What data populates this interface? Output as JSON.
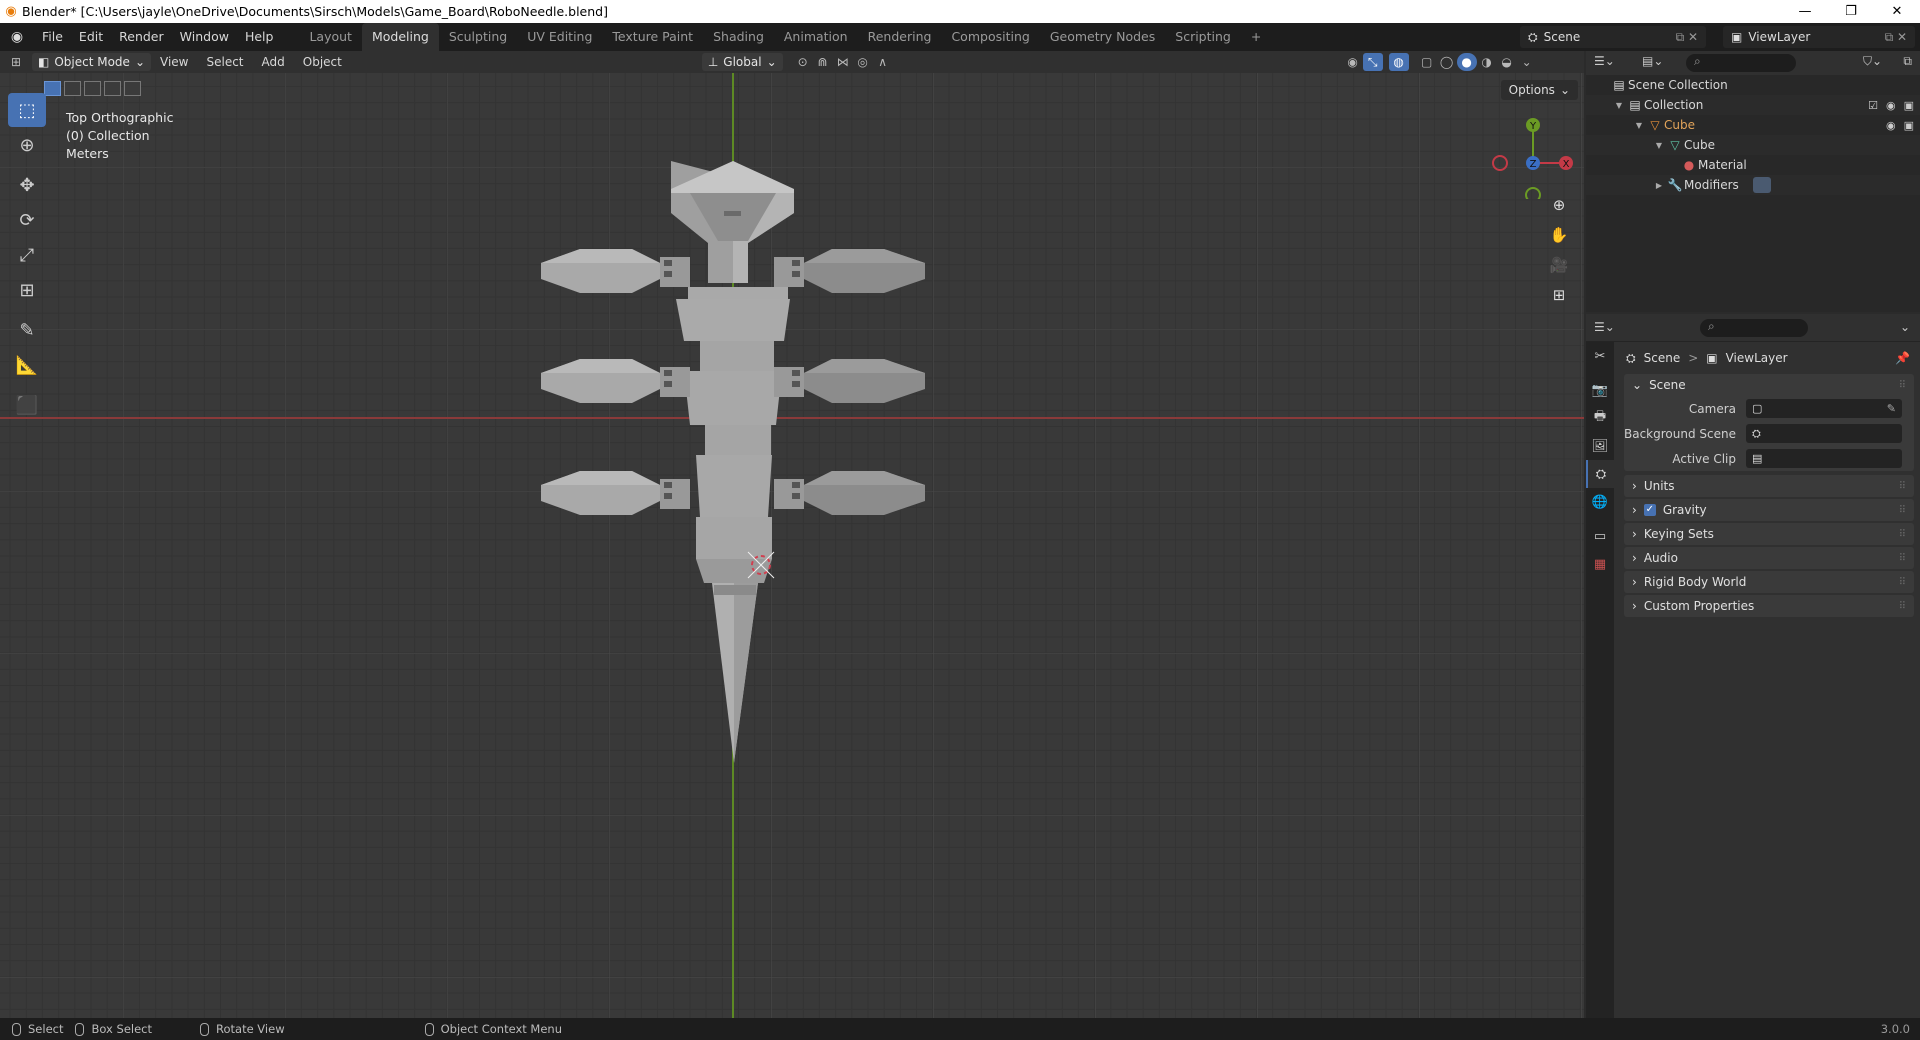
{
  "titlebar": {
    "title": "Blender* [C:\\Users\\jayle\\OneDrive\\Documents\\Sirsch\\Models\\Game_Board\\RoboNeedle.blend]",
    "minimize": "—",
    "maximize": "❐",
    "close": "✕"
  },
  "menu": {
    "items": [
      "File",
      "Edit",
      "Render",
      "Window",
      "Help"
    ],
    "workspaces": [
      "Layout",
      "Modeling",
      "Sculpting",
      "UV Editing",
      "Texture Paint",
      "Shading",
      "Animation",
      "Rendering",
      "Compositing",
      "Geometry Nodes",
      "Scripting"
    ],
    "add_workspace": "+",
    "active_workspace": "Modeling",
    "scene": "Scene",
    "view_layer": "ViewLayer"
  },
  "viewport_header": {
    "mode": "Object Mode",
    "menus": [
      "View",
      "Select",
      "Add",
      "Object"
    ],
    "orientation": "Global"
  },
  "viewport": {
    "view_name": "Top Orthographic",
    "collection": "(0) Collection",
    "units": "Meters",
    "options": "Options",
    "gizmo": {
      "y": "Y",
      "z": "Z",
      "x": "X"
    },
    "colors": {
      "x_axis": "#c43a47",
      "y_axis": "#6b9b24",
      "z_axis": "#3a6fc4",
      "mesh": "#a9a9a9",
      "mesh_dark": "#828282",
      "active_tool": "#4772b3"
    }
  },
  "outliner": {
    "root": "Scene Collection",
    "rows": [
      {
        "label": "Collection",
        "icon": "collection-icon"
      },
      {
        "label": "Cube",
        "icon": "object-icon"
      },
      {
        "label": "Cube",
        "icon": "mesh-data-icon"
      },
      {
        "label": "Material",
        "icon": "material-icon"
      },
      {
        "label": "Modifiers",
        "icon": "wrench-icon"
      }
    ]
  },
  "properties": {
    "breadcrumb": {
      "scene": "Scene",
      "separator": ">",
      "view_layer": "ViewLayer"
    },
    "scene_panel": {
      "title": "Scene",
      "fields": [
        {
          "label": "Camera",
          "value": ""
        },
        {
          "label": "Background Scene",
          "value": ""
        },
        {
          "label": "Active Clip",
          "value": ""
        }
      ]
    },
    "panels": [
      "Units",
      "Gravity",
      "Keying Sets",
      "Audio",
      "Rigid Body World",
      "Custom Properties"
    ],
    "gravity_checked": true
  },
  "statusbar": {
    "select": "Select",
    "box_select": "Box Select",
    "rotate": "Rotate View",
    "context_menu": "Object Context Menu",
    "version": "3.0.0"
  }
}
